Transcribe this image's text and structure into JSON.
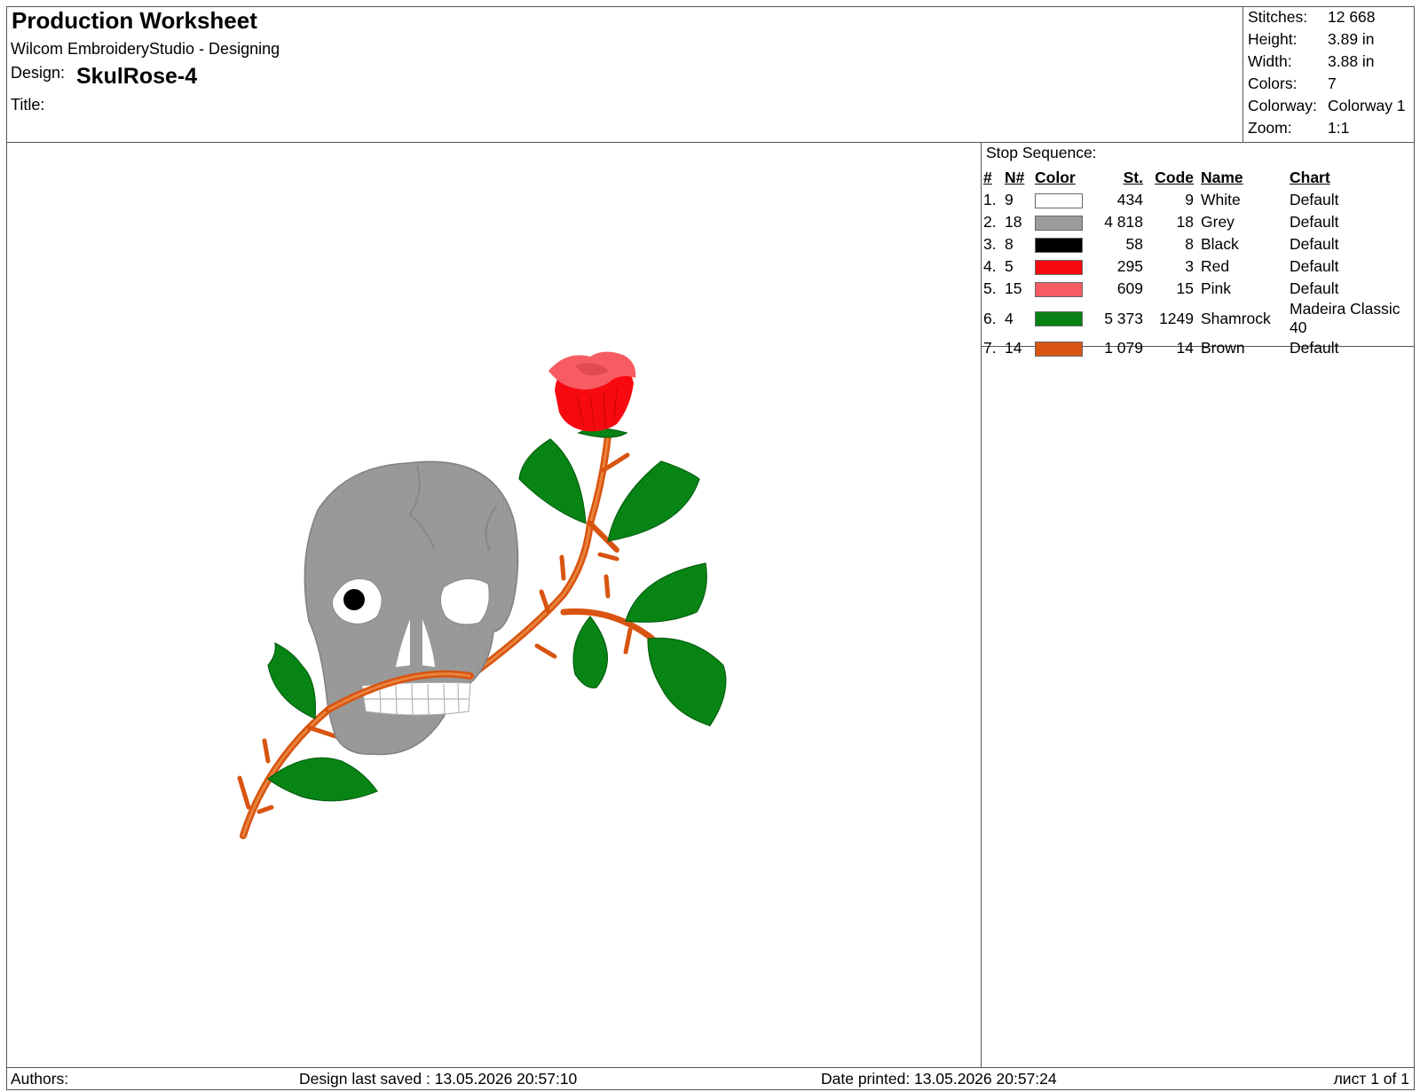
{
  "header": {
    "title": "Production Worksheet",
    "app": "Wilcom EmbroideryStudio - Designing",
    "design_label": "Design:",
    "design_name": "SkulRose-4",
    "title_label": "Title:"
  },
  "stats": [
    {
      "label": "Stitches:",
      "value": "12 668"
    },
    {
      "label": "Height:",
      "value": "3.89 in"
    },
    {
      "label": "Width:",
      "value": "3.88 in"
    },
    {
      "label": "Colors:",
      "value": "7"
    },
    {
      "label": "Colorway:",
      "value": "Colorway 1"
    },
    {
      "label": "Zoom:",
      "value": "1:1"
    }
  ],
  "stop_sequence": {
    "caption": "Stop Sequence:",
    "columns": [
      "#",
      "N#",
      "Color",
      "St.",
      "Code",
      "Name",
      "Chart"
    ],
    "rows": [
      {
        "index": "1.",
        "n": "9",
        "color": "#FFFFFF",
        "stitches": "434",
        "code": "9",
        "name": "White",
        "chart": "Default"
      },
      {
        "index": "2.",
        "n": "18",
        "color": "#9B9B9B",
        "stitches": "4 818",
        "code": "18",
        "name": "Grey",
        "chart": "Default"
      },
      {
        "index": "3.",
        "n": "8",
        "color": "#000000",
        "stitches": "58",
        "code": "8",
        "name": "Black",
        "chart": "Default"
      },
      {
        "index": "4.",
        "n": "5",
        "color": "#F70A0F",
        "stitches": "295",
        "code": "3",
        "name": "Red",
        "chart": "Default"
      },
      {
        "index": "5.",
        "n": "15",
        "color": "#F75C63",
        "stitches": "609",
        "code": "15",
        "name": "Pink",
        "chart": "Default"
      },
      {
        "index": "6.",
        "n": "4",
        "color": "#078114",
        "stitches": "5 373",
        "code": "1249",
        "name": "Shamrock",
        "chart": "Madeira Classic 40"
      },
      {
        "index": "7.",
        "n": "14",
        "color": "#D85410",
        "stitches": "1 079",
        "code": "14",
        "name": "Brown",
        "chart": "Default"
      }
    ]
  },
  "footer": {
    "authors_label": "Authors:",
    "saved": "Design last saved : 13.05.2026 20:57:10",
    "printed": "Date printed: 13.05.2026 20:57:24",
    "page": "лист 1 of 1"
  },
  "colors": {
    "skull": "#9B9B9B",
    "skull_shadow": "#7e7e7e",
    "teeth": "#FFFFFF",
    "eye": "#000000",
    "rose_red": "#F70A0F",
    "rose_pink": "#F75C63",
    "leaf": "#078114",
    "leaf_dark": "#055f0f",
    "stem": "#D85410",
    "stem_light": "#e8833c"
  }
}
